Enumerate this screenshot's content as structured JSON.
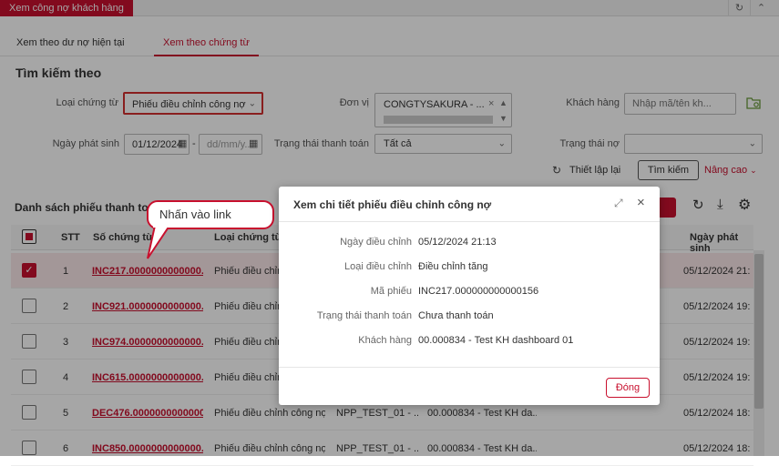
{
  "app": {
    "tab_title": "Xem công nợ khách hàng"
  },
  "tabs": [
    {
      "label": "Xem theo dư nợ hiện tại"
    },
    {
      "label": "Xem theo chứng từ"
    }
  ],
  "search": {
    "title": "Tìm kiếm theo",
    "doc_type_label": "Loại chứng từ",
    "doc_type_value": "Phiếu điều chỉnh công nợ",
    "unit_label": "Đơn vị",
    "unit_value": "CONGTYSAKURA - ...",
    "customer_label": "Khách hàng",
    "customer_placeholder": "Nhập mã/tên kh...",
    "date_label": "Ngày phát sinh",
    "date_from": "01/12/2024",
    "date_to_placeholder": "dd/mm/y...",
    "date_sep": "-",
    "pay_status_label": "Trạng thái thanh toán",
    "pay_status_value": "Tất cả",
    "debt_status_label": "Trạng thái nợ",
    "reset_label": "Thiết lập lại",
    "search_button": "Tìm kiếm",
    "advanced_label": "Nâng cao"
  },
  "list": {
    "title": "Danh sách phiếu thanh toán",
    "columns": {
      "stt": "STT",
      "doc_no": "Số chứng từ",
      "doc_type": "Loại chứng từ",
      "date": "Ngày phát sinh"
    },
    "rows": [
      {
        "stt": "1",
        "doc_no": "INC217.0000000000000...",
        "doc_type": "Phiếu điều chỉnh công nợ",
        "unit": "",
        "customer": "",
        "date": "05/12/2024 21:",
        "checked": true
      },
      {
        "stt": "2",
        "doc_no": "INC921.0000000000000...",
        "doc_type": "Phiếu điều chỉnh công nợ",
        "unit": "",
        "customer": "",
        "date": "05/12/2024 19:",
        "checked": false
      },
      {
        "stt": "3",
        "doc_no": "INC974.0000000000000...",
        "doc_type": "Phiếu điều chỉnh công nợ",
        "unit": "",
        "customer": "",
        "date": "05/12/2024 19:",
        "checked": false
      },
      {
        "stt": "4",
        "doc_no": "INC615.0000000000000...",
        "doc_type": "Phiếu điều chỉnh công nợ",
        "unit": "",
        "customer": "",
        "date": "05/12/2024 19:",
        "checked": false
      },
      {
        "stt": "5",
        "doc_no": "DEC476.0000000000000...",
        "doc_type": "Phiếu điều chỉnh công nợ",
        "unit": "NPP_TEST_01 - ...",
        "customer": "00.000834 - Test KH da...",
        "date": "05/12/2024 18:",
        "checked": false
      },
      {
        "stt": "6",
        "doc_no": "INC850.0000000000000...",
        "doc_type": "Phiếu điều chỉnh công nợ",
        "unit": "NPP_TEST_01 - ...",
        "customer": "00.000834 - Test KH da...",
        "date": "05/12/2024 18:",
        "checked": false
      }
    ]
  },
  "callout": {
    "text": "Nhấn vào link"
  },
  "modal": {
    "title": "Xem chi tiết phiếu điều chỉnh công nợ",
    "fields": [
      {
        "label": "Ngày điều chỉnh",
        "value": "05/12/2024 21:13"
      },
      {
        "label": "Loại điều chỉnh",
        "value": "Điều chỉnh tăng"
      },
      {
        "label": "Mã phiếu",
        "value": "INC217.000000000000156"
      },
      {
        "label": "Trạng thái thanh toán",
        "value": "Chưa thanh toán"
      },
      {
        "label": "Khách hàng",
        "value": "00.000834 - Test KH dashboard 01"
      }
    ],
    "close_label": "Đóng"
  },
  "colors": {
    "brand": "#c8102e"
  }
}
